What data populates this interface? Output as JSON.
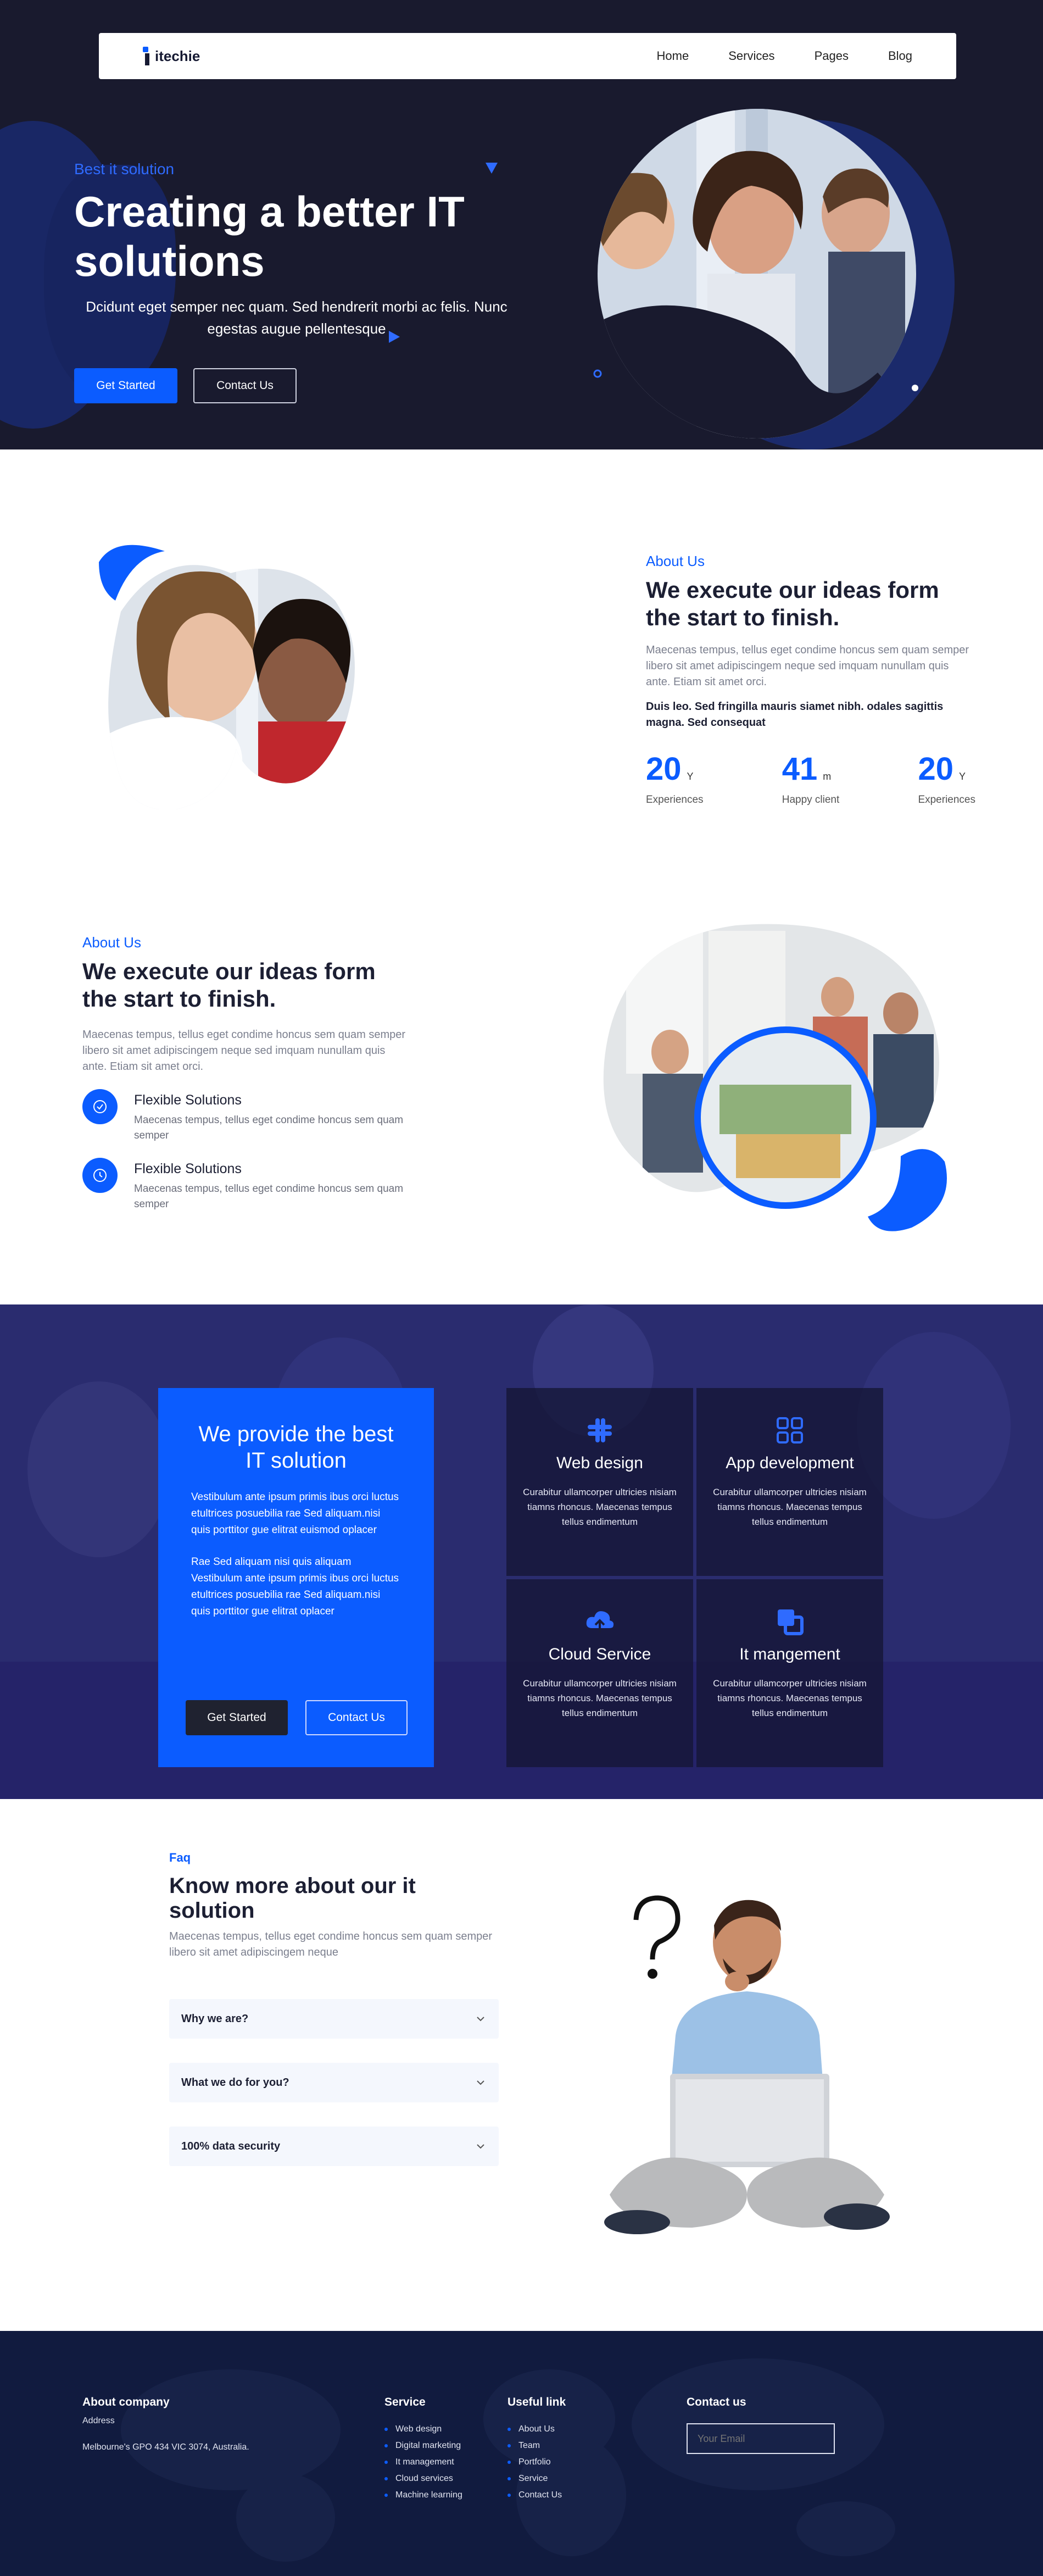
{
  "nav": {
    "logo": "itechie",
    "items": [
      "Home",
      "Services",
      "Pages",
      "Blog"
    ]
  },
  "hero": {
    "kicker": "Best it solution",
    "title": "Creating a better IT solutions",
    "desc": "Dcidunt eget semper nec quam. Sed hendrerit morbi ac felis. Nunc egestas augue pellentesque",
    "btn_primary": "Get Started",
    "btn_secondary": "Contact Us"
  },
  "about1": {
    "kicker": "About Us",
    "title": "We execute our ideas form the start to finish.",
    "desc": "Maecenas tempus, tellus eget condime honcus sem quam semper libero sit amet adipiscingem neque sed imquam nunullam quis ante. Etiam sit amet orci.",
    "bold": "Duis leo. Sed fringilla mauris siamet nibh. odales sagittis magna. Sed consequat",
    "stats": [
      {
        "num": "20",
        "unit": "Y",
        "label": "Experiences"
      },
      {
        "num": "41",
        "unit": "m",
        "label": "Happy client"
      },
      {
        "num": "20",
        "unit": "Y",
        "label": "Experiences"
      }
    ]
  },
  "about2": {
    "kicker": "About Us",
    "title": "We execute our ideas form the start to finish.",
    "desc": "Maecenas tempus, tellus eget condime honcus sem quam semper libero sit amet adipiscingem neque sed imquam nunullam quis ante. Etiam sit amet orci.",
    "features": [
      {
        "title": "Flexible Solutions",
        "desc": "Maecenas tempus, tellus eget condime honcus sem quam semper"
      },
      {
        "title": "Flexible Solutions",
        "desc": "Maecenas tempus, tellus eget condime honcus sem quam semper"
      }
    ]
  },
  "services": {
    "title": "We provide the best IT solution",
    "p1": "Vestibulum ante ipsum primis ibus orci luctus etultrices posuebilia rae Sed aliquam.nisi quis porttitor gue elitrat euismod oplacer",
    "p2": "Rae Sed aliquam nisi quis aliquam Vestibulum ante ipsum primis ibus orci luctus etultrices posuebilia rae Sed aliquam.nisi quis porttitor gue elitrat oplacer",
    "btn_primary": "Get Started",
    "btn_secondary": "Contact Us",
    "tiles": [
      {
        "title": "Web design",
        "icon": "slack-icon",
        "desc": "Curabitur ullamcorper ultricies nisiam tiamns rhoncus. Maecenas tempus tellus endimentum"
      },
      {
        "title": "App development",
        "icon": "apps-grid-icon",
        "desc": "Curabitur ullamcorper ultricies nisiam tiamns rhoncus. Maecenas tempus tellus endimentum"
      },
      {
        "title": "Cloud Service",
        "icon": "cloud-upload-icon",
        "desc": "Curabitur ullamcorper ultricies nisiam tiamns rhoncus. Maecenas tempus tellus endimentum"
      },
      {
        "title": "It mangement",
        "icon": "layers-icon",
        "desc": "Curabitur ullamcorper ultricies nisiam tiamns rhoncus. Maecenas tempus tellus endimentum"
      }
    ]
  },
  "faq": {
    "kicker": "Faq",
    "title": "Know more about our it solution",
    "desc": "Maecenas tempus, tellus eget condime honcus sem quam semper libero sit amet adipiscingem neque",
    "items": [
      "Why we are?",
      "What we do for you?",
      "100% data security"
    ]
  },
  "footer": {
    "company": {
      "title": "About company",
      "address_label": "Address",
      "address": "Melbourne's GPO 434 VIC 3074, Australia."
    },
    "service": {
      "title": "Service",
      "items": [
        "Web design",
        "Digital marketing",
        "It management",
        "Cloud services",
        "Machine learning"
      ]
    },
    "useful": {
      "title": "Useful link",
      "items": [
        "About Us",
        "Team",
        "Portfolio",
        "Service",
        "Contact Us"
      ]
    },
    "contact": {
      "title": "Contact us",
      "placeholder": "Your Email"
    }
  },
  "colors": {
    "accent": "#0b5cff",
    "hero_bg": "#191a2e",
    "footer_bg": "#111b3f"
  }
}
